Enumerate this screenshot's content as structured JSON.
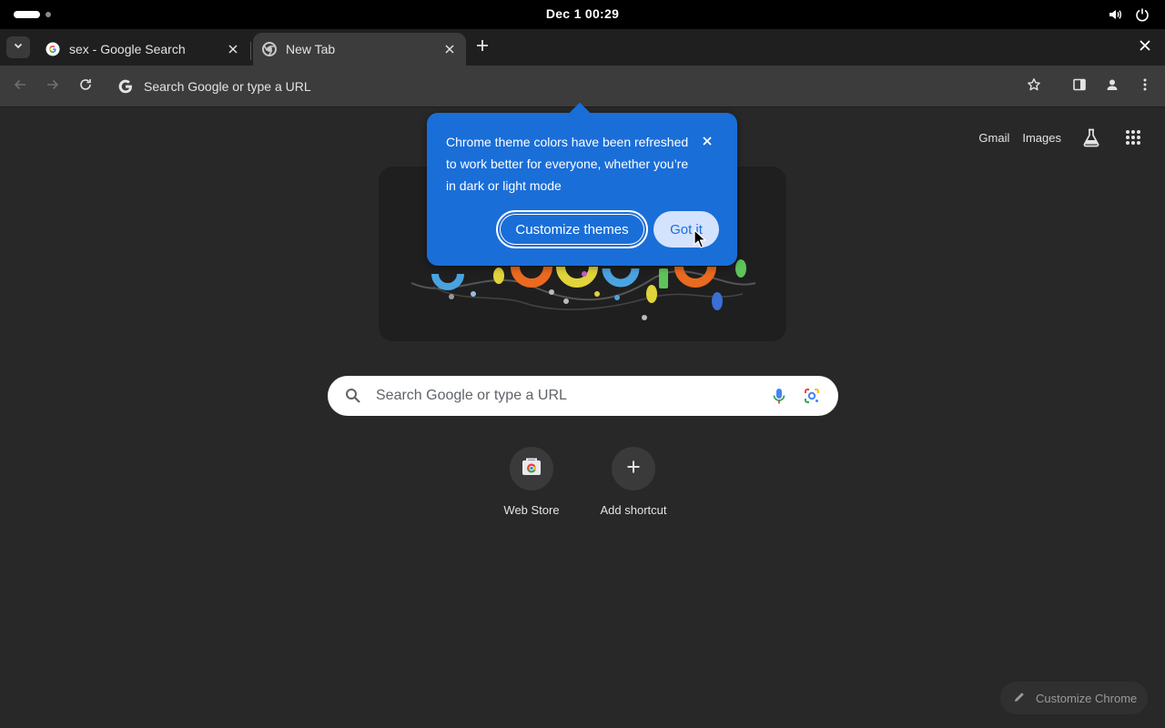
{
  "system": {
    "clock": "Dec 1  00:29",
    "icons": [
      "volume-icon",
      "power-icon"
    ]
  },
  "tabs": [
    {
      "title": "sex - Google Search",
      "favicon": "google-g-icon",
      "active": false
    },
    {
      "title": "New Tab",
      "favicon": "chrome-icon",
      "active": true
    }
  ],
  "toolbar": {
    "omnibox_text": "Search Google or type a URL"
  },
  "ntp": {
    "header_links": {
      "gmail": "Gmail",
      "images": "Images"
    },
    "search_placeholder": "Search Google or type a URL",
    "shortcuts": [
      {
        "label": "Web Store",
        "icon": "web-store-icon"
      },
      {
        "label": "Add shortcut",
        "icon": "plus-icon"
      }
    ],
    "customize_chrome_label": "Customize Chrome"
  },
  "bubble": {
    "message": "Chrome theme colors have been refreshed to work better for everyone, whether you’re in dark or light mode",
    "customize_label": "Customize themes",
    "gotit_label": "Got it"
  },
  "colors": {
    "bubble_bg": "#1a6ed8",
    "page_bg": "#282828",
    "toolbar_bg": "#3c3c3c"
  }
}
